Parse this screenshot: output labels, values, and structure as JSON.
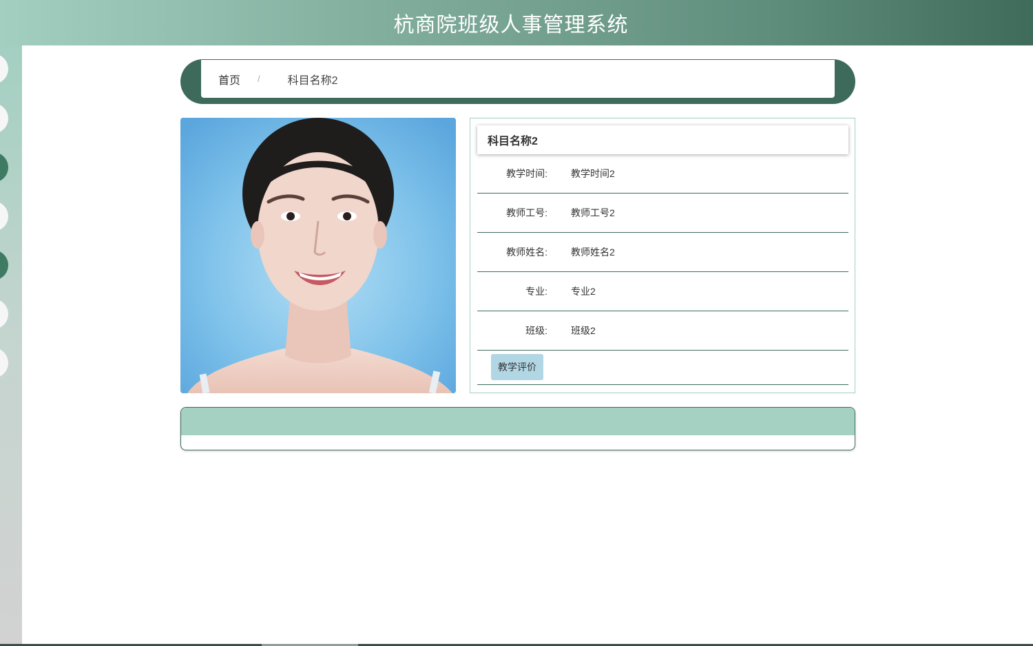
{
  "header": {
    "title": "杭商院班级人事管理系统"
  },
  "sidebar": {
    "items": [
      {
        "active": false
      },
      {
        "active": false
      },
      {
        "active": true
      },
      {
        "active": false
      },
      {
        "active": true
      },
      {
        "active": false
      },
      {
        "active": false
      }
    ]
  },
  "breadcrumb": {
    "home": "首页",
    "separator": "/",
    "current": "科目名称2"
  },
  "detail": {
    "title": "科目名称2",
    "fields": [
      {
        "label": "教学时间:",
        "value": "教学时间2"
      },
      {
        "label": "教师工号:",
        "value": "教师工号2"
      },
      {
        "label": "教师姓名:",
        "value": "教师姓名2"
      },
      {
        "label": "专业:",
        "value": "专业2"
      },
      {
        "label": "班级:",
        "value": "班级2"
      }
    ],
    "action_label": "教学评价"
  },
  "colors": {
    "accent_dark": "#3d6a5b",
    "accent_light": "#a3cfc1",
    "button_bg": "#b2d7e4"
  }
}
